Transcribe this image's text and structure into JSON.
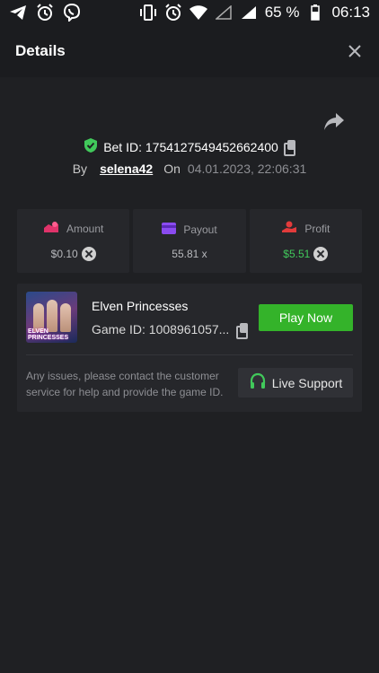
{
  "statusbar": {
    "battery": "65 %",
    "time": "06:13"
  },
  "header": {
    "title": "Details"
  },
  "bet": {
    "id_text": "Bet ID: 1754127549452662400",
    "by_label": "By",
    "username": "selena42",
    "on_label": "On",
    "datetime": "04.01.2023, 22:06:31"
  },
  "stats": {
    "amount": {
      "label": "Amount",
      "value": "$0.10"
    },
    "payout": {
      "label": "Payout",
      "value": "55.81 x"
    },
    "profit": {
      "label": "Profit",
      "value": "$5.51"
    }
  },
  "game": {
    "name": "Elven Princesses",
    "id_text": "Game ID: 1008961057...",
    "thumb_text": "ELVEN PRINCESSES",
    "play_label": "Play Now",
    "issues_text": "Any issues, please contact the customer service for help and provide the game ID.",
    "support_label": "Live Support"
  },
  "colors": {
    "accent_green": "#34b32a",
    "profit_green": "#41c95b",
    "amount_icon": "#e0336a",
    "payout_icon": "#8a4bf0",
    "profit_icon": "#e23b3b"
  }
}
